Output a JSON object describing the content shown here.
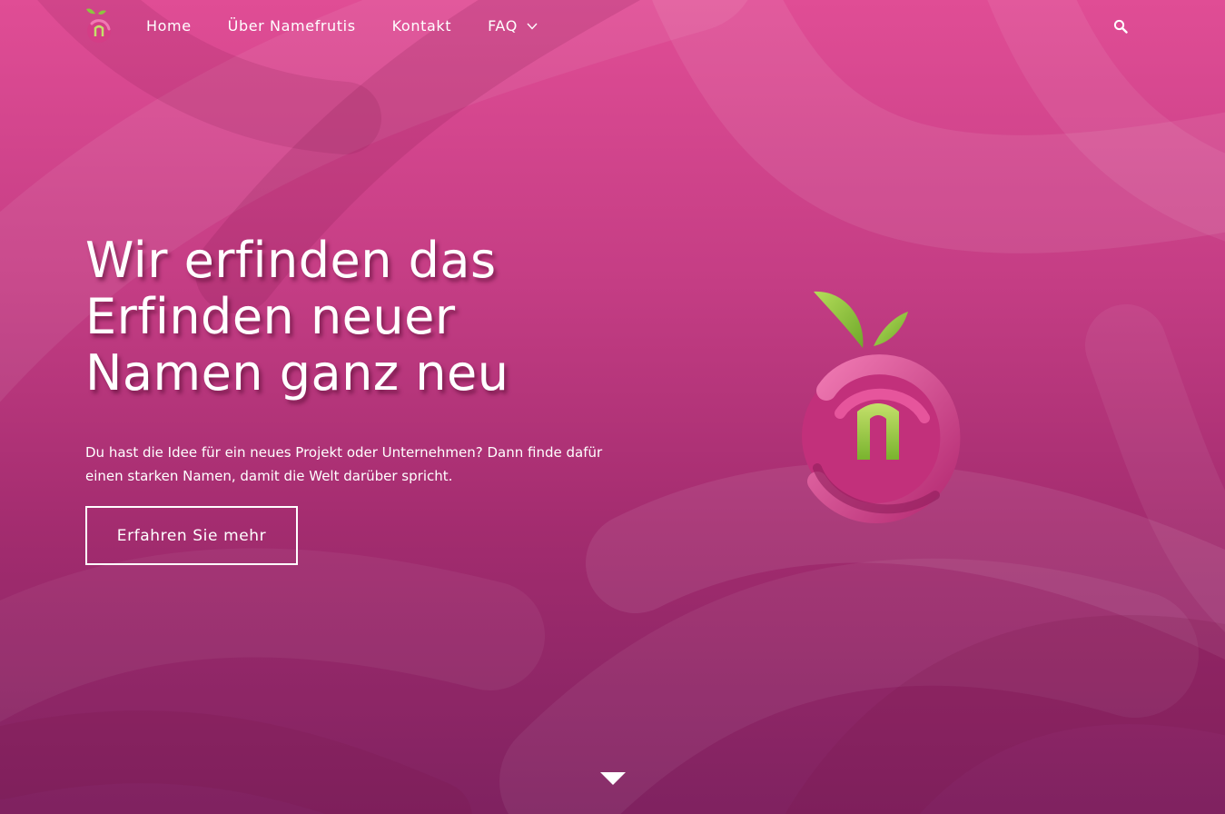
{
  "nav": {
    "items": [
      {
        "label": "Home"
      },
      {
        "label": "Über Namefrutis"
      },
      {
        "label": "Kontakt"
      },
      {
        "label": "FAQ",
        "has_dropdown": true
      }
    ],
    "logo_letter": "n",
    "search_icon": "search-icon"
  },
  "hero": {
    "headline_lines": [
      "Wir erfinden das",
      "Erfinden neuer",
      "Namen ganz neu"
    ],
    "subtext_lines": [
      "Du hast die Idee für ein neues Projekt oder Unternehmen? Dann finde dafür",
      "einen starken Namen, damit die Welt darüber spricht."
    ],
    "cta_label": "Erfahren Sie mehr",
    "logo_letter": "n",
    "scroll_icon": "chevron-down-icon"
  },
  "colors": {
    "background_top": "#e04d95",
    "background_bottom": "#7f2260",
    "leaf_green": "#8cc63f",
    "text": "#ffffff"
  }
}
